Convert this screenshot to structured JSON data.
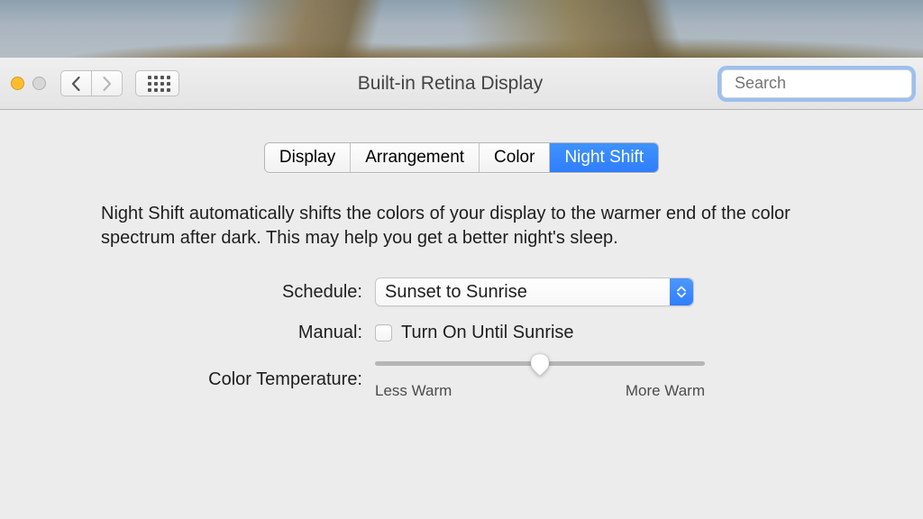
{
  "window": {
    "title": "Built-in Retina Display"
  },
  "search": {
    "placeholder": "Search"
  },
  "tabs": [
    {
      "label": "Display",
      "active": false
    },
    {
      "label": "Arrangement",
      "active": false
    },
    {
      "label": "Color",
      "active": false
    },
    {
      "label": "Night Shift",
      "active": true
    }
  ],
  "description": "Night Shift automatically shifts the colors of your display to the warmer end of the color spectrum after dark. This may help you get a better night's sleep.",
  "schedule": {
    "label": "Schedule:",
    "value": "Sunset to Sunrise"
  },
  "manual": {
    "label": "Manual:",
    "checkbox_label": "Turn On Until Sunrise",
    "checked": false
  },
  "color_temperature": {
    "label": "Color Temperature:",
    "min_label": "Less Warm",
    "max_label": "More Warm",
    "value": 50,
    "min": 0,
    "max": 100
  },
  "colors": {
    "accent": "#2f7efe"
  }
}
